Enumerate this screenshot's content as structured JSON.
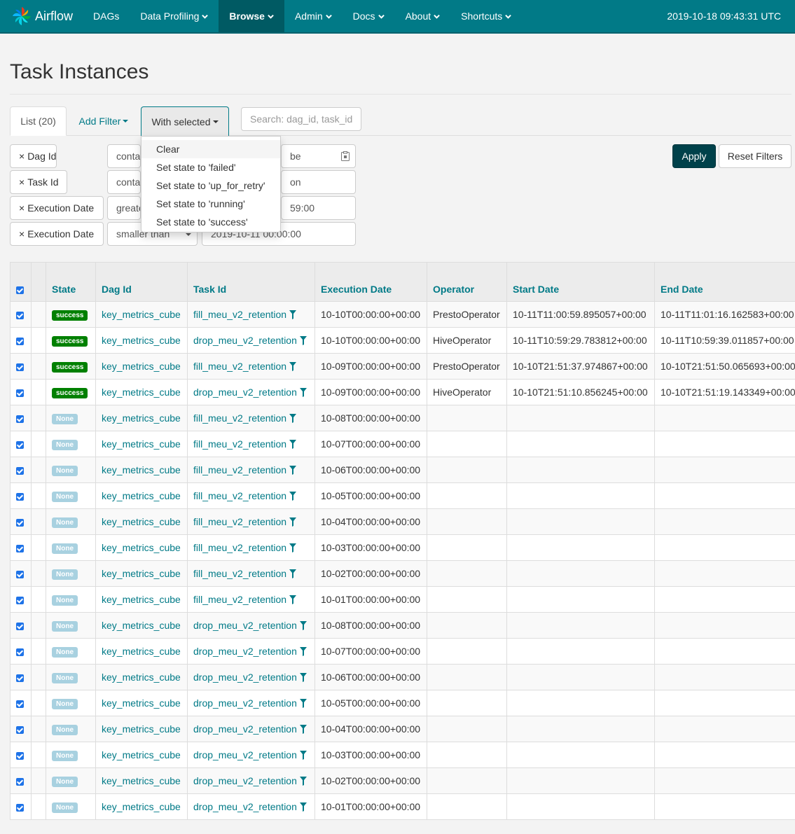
{
  "colors": {
    "nav_bg": "#017a87",
    "nav_active": "#005a63",
    "link": "#017a87",
    "success": "#008000",
    "none_state": "#a8d1e0",
    "apply_bg": "#00414a",
    "checkbox": "#1e73e8"
  },
  "nav": {
    "brand": "Airflow",
    "items": [
      {
        "label": "DAGs",
        "dropdown": false,
        "active": false
      },
      {
        "label": "Data Profiling",
        "dropdown": true,
        "active": false
      },
      {
        "label": "Browse",
        "dropdown": true,
        "active": true
      },
      {
        "label": "Admin",
        "dropdown": true,
        "active": false
      },
      {
        "label": "Docs",
        "dropdown": true,
        "active": false
      },
      {
        "label": "About",
        "dropdown": true,
        "active": false
      },
      {
        "label": "Shortcuts",
        "dropdown": true,
        "active": false
      }
    ],
    "clock": "2019-10-18 09:43:31 UTC"
  },
  "page_title": "Task Instances",
  "tabs": {
    "list": "List (20)",
    "add_filter": "Add Filter",
    "with_selected": "With selected"
  },
  "search": {
    "placeholder": "Search: dag_id, task_id"
  },
  "filters": [
    {
      "field": "Dag Id",
      "op": "conta",
      "value": "be"
    },
    {
      "field": "Task Id",
      "op": "conta",
      "value": "on"
    },
    {
      "field": "Execution Date",
      "op": "greate",
      "value": "59:00"
    },
    {
      "field": "Execution Date",
      "op": "smaller than",
      "value": "2019-10-11 00:00:00"
    }
  ],
  "buttons": {
    "apply": "Apply",
    "reset": "Reset Filters"
  },
  "dropdown_items": [
    "Clear",
    "Set state to 'failed'",
    "Set state to 'up_for_retry'",
    "Set state to 'running'",
    "Set state to 'success'"
  ],
  "table": {
    "columns": [
      "State",
      "Dag Id",
      "Task Id",
      "Execution Date",
      "Operator",
      "Start Date",
      "End Date"
    ],
    "rows": [
      {
        "state": "success",
        "dag_id": "key_metrics_cube",
        "task_id": "fill_meu_v2_retention",
        "exec": "10-10T00:00:00+00:00",
        "op": "PrestoOperator",
        "start": "10-11T11:00:59.895057+00:00",
        "end": "10-11T11:01:16.162583+00:00"
      },
      {
        "state": "success",
        "dag_id": "key_metrics_cube",
        "task_id": "drop_meu_v2_retention",
        "exec": "10-10T00:00:00+00:00",
        "op": "HiveOperator",
        "start": "10-11T10:59:29.783812+00:00",
        "end": "10-11T10:59:39.011857+00:00"
      },
      {
        "state": "success",
        "dag_id": "key_metrics_cube",
        "task_id": "fill_meu_v2_retention",
        "exec": "10-09T00:00:00+00:00",
        "op": "PrestoOperator",
        "start": "10-10T21:51:37.974867+00:00",
        "end": "10-10T21:51:50.065693+00:00"
      },
      {
        "state": "success",
        "dag_id": "key_metrics_cube",
        "task_id": "drop_meu_v2_retention",
        "exec": "10-09T00:00:00+00:00",
        "op": "HiveOperator",
        "start": "10-10T21:51:10.856245+00:00",
        "end": "10-10T21:51:19.143349+00:00"
      },
      {
        "state": "None",
        "dag_id": "key_metrics_cube",
        "task_id": "fill_meu_v2_retention",
        "exec": "10-08T00:00:00+00:00",
        "op": "",
        "start": "",
        "end": ""
      },
      {
        "state": "None",
        "dag_id": "key_metrics_cube",
        "task_id": "fill_meu_v2_retention",
        "exec": "10-07T00:00:00+00:00",
        "op": "",
        "start": "",
        "end": ""
      },
      {
        "state": "None",
        "dag_id": "key_metrics_cube",
        "task_id": "fill_meu_v2_retention",
        "exec": "10-06T00:00:00+00:00",
        "op": "",
        "start": "",
        "end": ""
      },
      {
        "state": "None",
        "dag_id": "key_metrics_cube",
        "task_id": "fill_meu_v2_retention",
        "exec": "10-05T00:00:00+00:00",
        "op": "",
        "start": "",
        "end": ""
      },
      {
        "state": "None",
        "dag_id": "key_metrics_cube",
        "task_id": "fill_meu_v2_retention",
        "exec": "10-04T00:00:00+00:00",
        "op": "",
        "start": "",
        "end": ""
      },
      {
        "state": "None",
        "dag_id": "key_metrics_cube",
        "task_id": "fill_meu_v2_retention",
        "exec": "10-03T00:00:00+00:00",
        "op": "",
        "start": "",
        "end": ""
      },
      {
        "state": "None",
        "dag_id": "key_metrics_cube",
        "task_id": "fill_meu_v2_retention",
        "exec": "10-02T00:00:00+00:00",
        "op": "",
        "start": "",
        "end": ""
      },
      {
        "state": "None",
        "dag_id": "key_metrics_cube",
        "task_id": "fill_meu_v2_retention",
        "exec": "10-01T00:00:00+00:00",
        "op": "",
        "start": "",
        "end": ""
      },
      {
        "state": "None",
        "dag_id": "key_metrics_cube",
        "task_id": "drop_meu_v2_retention",
        "exec": "10-08T00:00:00+00:00",
        "op": "",
        "start": "",
        "end": ""
      },
      {
        "state": "None",
        "dag_id": "key_metrics_cube",
        "task_id": "drop_meu_v2_retention",
        "exec": "10-07T00:00:00+00:00",
        "op": "",
        "start": "",
        "end": ""
      },
      {
        "state": "None",
        "dag_id": "key_metrics_cube",
        "task_id": "drop_meu_v2_retention",
        "exec": "10-06T00:00:00+00:00",
        "op": "",
        "start": "",
        "end": ""
      },
      {
        "state": "None",
        "dag_id": "key_metrics_cube",
        "task_id": "drop_meu_v2_retention",
        "exec": "10-05T00:00:00+00:00",
        "op": "",
        "start": "",
        "end": ""
      },
      {
        "state": "None",
        "dag_id": "key_metrics_cube",
        "task_id": "drop_meu_v2_retention",
        "exec": "10-04T00:00:00+00:00",
        "op": "",
        "start": "",
        "end": ""
      },
      {
        "state": "None",
        "dag_id": "key_metrics_cube",
        "task_id": "drop_meu_v2_retention",
        "exec": "10-03T00:00:00+00:00",
        "op": "",
        "start": "",
        "end": ""
      },
      {
        "state": "None",
        "dag_id": "key_metrics_cube",
        "task_id": "drop_meu_v2_retention",
        "exec": "10-02T00:00:00+00:00",
        "op": "",
        "start": "",
        "end": ""
      },
      {
        "state": "None",
        "dag_id": "key_metrics_cube",
        "task_id": "drop_meu_v2_retention",
        "exec": "10-01T00:00:00+00:00",
        "op": "",
        "start": "",
        "end": ""
      }
    ]
  }
}
